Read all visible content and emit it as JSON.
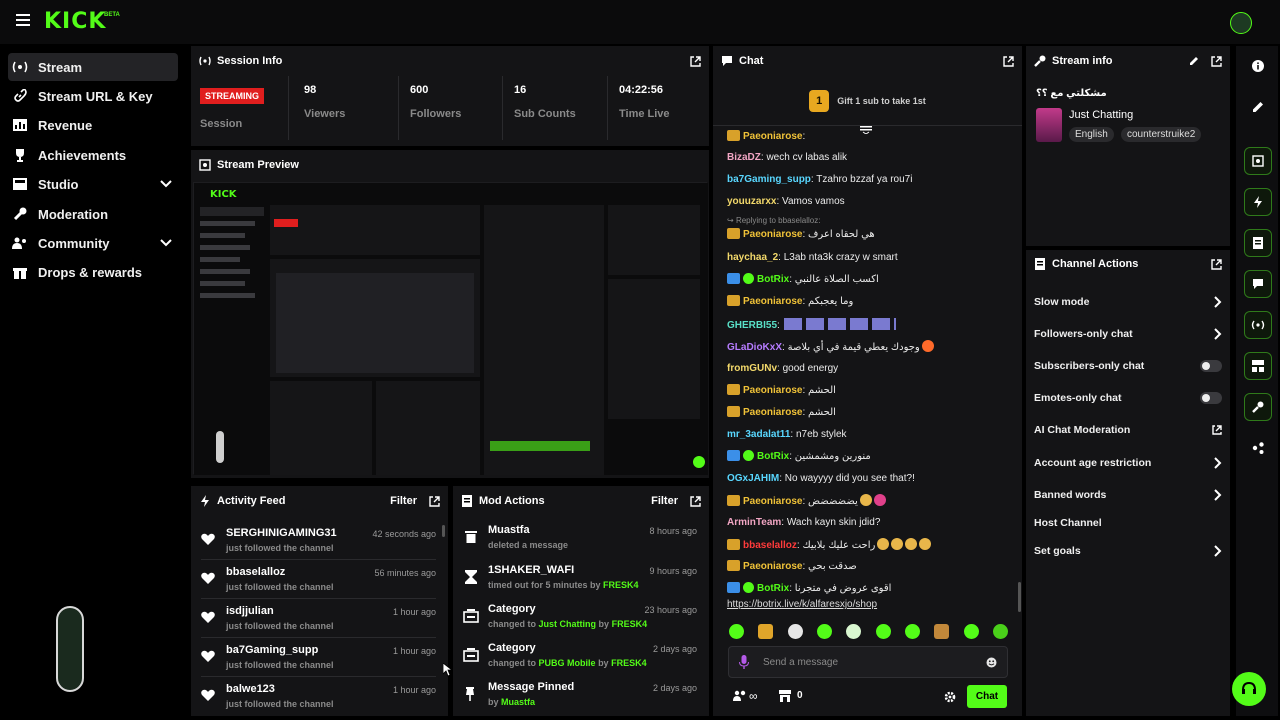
{
  "brand": {
    "logo": "KICK",
    "beta": "BETA",
    "color": "#53fc18"
  },
  "sidebar": {
    "items": [
      {
        "label": "Stream",
        "icon": "broadcast-icon",
        "active": true
      },
      {
        "label": "Stream URL & Key",
        "icon": "link-icon"
      },
      {
        "label": "Revenue",
        "icon": "chart-icon"
      },
      {
        "label": "Achievements",
        "icon": "trophy-icon"
      },
      {
        "label": "Studio",
        "icon": "studio-icon",
        "expandable": true
      },
      {
        "label": "Moderation",
        "icon": "wrench-icon"
      },
      {
        "label": "Community",
        "icon": "people-icon",
        "expandable": true
      },
      {
        "label": "Drops & rewards",
        "icon": "gift-icon"
      }
    ]
  },
  "session": {
    "title": "Session Info",
    "status": "STREAMING",
    "status_label": "Session",
    "stats": [
      {
        "value": "98",
        "label": "Viewers"
      },
      {
        "value": "600",
        "label": "Followers"
      },
      {
        "value": "16",
        "label": "Sub Counts"
      },
      {
        "value": "04:22:56",
        "label": "Time Live"
      }
    ]
  },
  "preview": {
    "title": "Stream Preview"
  },
  "activity": {
    "title": "Activity Feed",
    "filter": "Filter",
    "items": [
      {
        "name": "SERGHINIGAMING31",
        "action": "just followed the channel",
        "time": "42 seconds ago"
      },
      {
        "name": "bbaselalloz",
        "action": "just followed the channel",
        "time": "56 minutes ago"
      },
      {
        "name": "isdjjulian",
        "action": "just followed the channel",
        "time": "1 hour ago"
      },
      {
        "name": "ba7Gaming_supp",
        "action": "just followed the channel",
        "time": "1 hour ago"
      },
      {
        "name": "balwe123",
        "action": "just followed the channel",
        "time": "1 hour ago"
      }
    ]
  },
  "mod": {
    "title": "Mod Actions",
    "filter": "Filter",
    "items": [
      {
        "name": "Muastfa",
        "detail": "deleted a message",
        "time": "8 hours ago",
        "icon": "trash-icon"
      },
      {
        "name": "1SHAKER_WAFI",
        "detail": "timed out for 5 minutes by",
        "by": "FRESK4",
        "time": "9 hours ago",
        "icon": "hourglass-icon"
      },
      {
        "name": "Category",
        "detail": "changed to",
        "target": "Just Chatting",
        "by_word": "by",
        "by": "FRESK4",
        "time": "23 hours ago",
        "icon": "category-icon"
      },
      {
        "name": "Category",
        "detail": "changed to",
        "target": "PUBG Mobile",
        "by_word": "by",
        "by": "FRESK4",
        "time": "2 days ago",
        "icon": "category-icon"
      },
      {
        "name": "Message Pinned",
        "detail": "by",
        "by": "Muastfa",
        "time": "2 days ago",
        "icon": "pin-icon"
      }
    ]
  },
  "chat": {
    "title": "Chat",
    "gift_count": "1",
    "gift_text": "Gift 1 sub to take 1st",
    "messages": [
      {
        "user": "Paeoniarose",
        "color": "#f0c238",
        "text": ":",
        "badge": "crown"
      },
      {
        "user": "BizaDZ",
        "color": "#f2a6c4",
        "text": ": wech cv labas alik"
      },
      {
        "user": "ba7Gaming_supp",
        "color": "#59d7ff",
        "text": ": Tzahro bzzaf ya rou7i"
      },
      {
        "user": "youuzarxx",
        "color": "#f3d96b",
        "text": ": Vamos vamos"
      },
      {
        "user": "Paeoniarose",
        "color": "#f0c238",
        "text": ": هي لحقاه اعرف",
        "badge": "crown",
        "reply": "Replying to bbaselalloz:"
      },
      {
        "user": "haychaa_2",
        "color": "#f3d96b",
        "text": ": L3ab nta3k crazy w smart"
      },
      {
        "user": "BotRix",
        "color": "#53fc18",
        "text": ": اكسب الصلاة عالنبي",
        "badge": "bot"
      },
      {
        "user": "Paeoniarose",
        "color": "#f0c238",
        "text": ": وما يعجبكم",
        "badge": "crown"
      },
      {
        "user": "GHERBI55",
        "color": "#59e0c8",
        "text": ":"
      },
      {
        "user": "GLaDioKxX",
        "color": "#b67cff",
        "text": ": وجودك يعطي قيمة في أي بلاصة"
      },
      {
        "user": "fromGUNv",
        "color": "#f3d96b",
        "text": ": good energy"
      },
      {
        "user": "Paeoniarose",
        "color": "#f0c238",
        "text": ": الحشم",
        "badge": "crown"
      },
      {
        "user": "Paeoniarose",
        "color": "#f0c238",
        "text": ": الحشم",
        "badge": "crown"
      },
      {
        "user": "mr_3adalat11",
        "color": "#59d7ff",
        "text": ": n7eb stylek"
      },
      {
        "user": "BotRix",
        "color": "#53fc18",
        "text": ": منورين ومشمشين",
        "badge": "bot"
      },
      {
        "user": "OGxJAHIM",
        "color": "#59d7ff",
        "text": ": No wayyyy did you see that?!"
      },
      {
        "user": "Paeoniarose",
        "color": "#f0c238",
        "text": ": يضضضضض",
        "badge": "crown"
      },
      {
        "user": "ArminTeam",
        "color": "#f2a6c4",
        "text": ": Wach kayn skin jdid?"
      },
      {
        "user": "bbaselalloz",
        "color": "#ff3b3b",
        "text": ": راحت عليك بلابيك",
        "badge": "crown"
      },
      {
        "user": "Paeoniarose",
        "color": "#f0c238",
        "text": ": صدقت بحي",
        "badge": "crown"
      },
      {
        "user": "BotRix",
        "color": "#53fc18",
        "text": ": اقوى عروض في متجرنا",
        "badge": "bot"
      }
    ],
    "link": "https://botrix.live/k/alfaresxjo/shop",
    "input_placeholder": "Send a message",
    "points": "0",
    "send_label": "Chat"
  },
  "stream_info": {
    "title": "Stream info",
    "stream_title": "مشكلتي مع ؟؟",
    "category": "Just Chatting",
    "tags": [
      "English",
      "counterstruike2"
    ]
  },
  "channel_actions": {
    "title": "Channel Actions",
    "items": [
      {
        "label": "Slow mode",
        "control": "chevron"
      },
      {
        "label": "Followers-only chat",
        "control": "chevron"
      },
      {
        "label": "Subscribers-only chat",
        "control": "toggle"
      },
      {
        "label": "Emotes-only chat",
        "control": "toggle"
      },
      {
        "label": "AI Chat Moderation",
        "control": "external"
      },
      {
        "label": "Account age restriction",
        "control": "chevron"
      },
      {
        "label": "Banned words",
        "control": "chevron"
      },
      {
        "label": "Host Channel",
        "control": "none"
      },
      {
        "label": "Set goals",
        "control": "chevron"
      }
    ]
  },
  "rail": [
    "info-icon",
    "pencil-icon",
    "camera-icon",
    "bolt-icon",
    "document-icon",
    "chat-bubble-icon",
    "broadcast-icon",
    "layout-icon",
    "wrench-icon",
    "share-icon"
  ]
}
